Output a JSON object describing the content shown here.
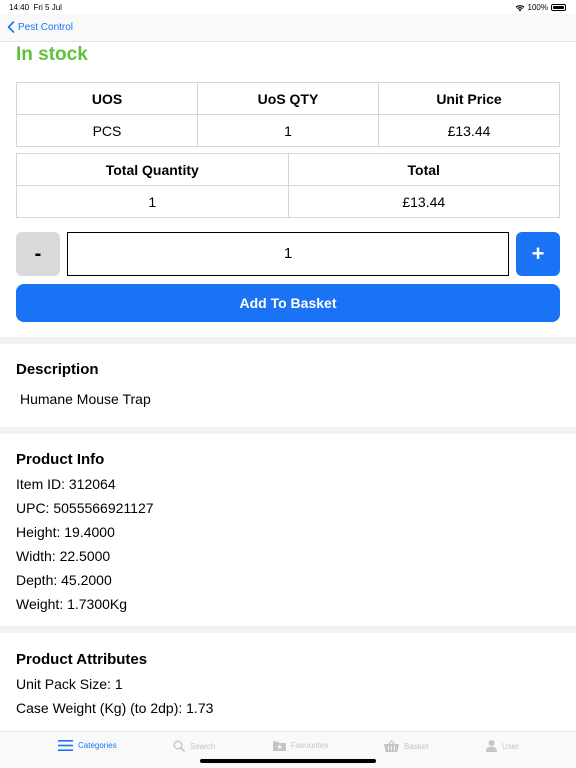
{
  "status": {
    "time": "14:40",
    "date": "Fri 5 Jul",
    "battery": "100%"
  },
  "nav": {
    "back_label": "Pest Control"
  },
  "stock_status": "In stock",
  "price_table": {
    "headers": [
      "UOS",
      "UoS QTY",
      "Unit Price"
    ],
    "row": [
      "PCS",
      "1",
      "£13.44"
    ]
  },
  "total_table": {
    "headers": [
      "Total Quantity",
      "Total"
    ],
    "row": [
      "1",
      "£13.44"
    ]
  },
  "quantity": {
    "minus_label": "-",
    "value": "1",
    "plus_label": "+"
  },
  "add_button_label": "Add To Basket",
  "description": {
    "title": "Description",
    "text": "Humane Mouse Trap"
  },
  "product_info": {
    "title": "Product Info",
    "lines": [
      "Item ID: 312064",
      "UPC: 5055566921127",
      "Height: 19.4000",
      "Width: 22.5000",
      "Depth: 45.2000",
      "Weight: 1.7300Kg"
    ]
  },
  "attributes": {
    "title": "Product Attributes",
    "lines": [
      "Unit Pack Size: 1",
      "Case Weight (Kg) (to 2dp): 1.73"
    ]
  },
  "tabs": [
    {
      "label": "Categories",
      "icon": "list-icon",
      "active": true
    },
    {
      "label": "Search",
      "icon": "search-icon",
      "active": false
    },
    {
      "label": "Favourites",
      "icon": "star-folder-icon",
      "active": false
    },
    {
      "label": "Basket",
      "icon": "basket-icon",
      "active": false
    },
    {
      "label": "User",
      "icon": "user-icon",
      "active": false
    }
  ],
  "colors": {
    "accent": "#1a73f5",
    "in_stock": "#5fc23a"
  }
}
